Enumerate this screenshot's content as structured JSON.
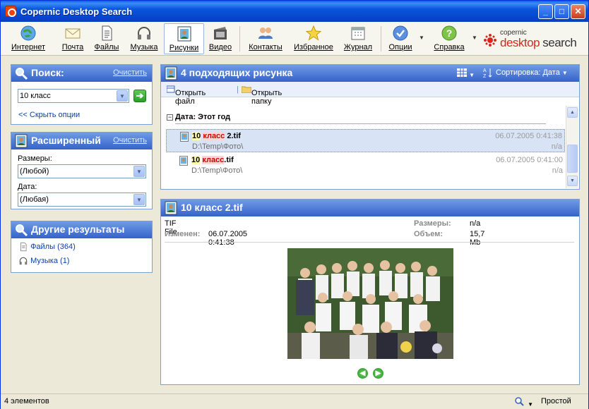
{
  "window": {
    "title": "Copernic Desktop Search"
  },
  "toolbar": {
    "items": [
      {
        "label": "Интернет",
        "icon": "globe-icon"
      },
      {
        "label": "Почта",
        "icon": "mail-icon"
      },
      {
        "label": "Файлы",
        "icon": "document-icon"
      },
      {
        "label": "Музыка",
        "icon": "headphones-icon"
      },
      {
        "label": "Рисунки",
        "icon": "picture-icon"
      },
      {
        "label": "Видео",
        "icon": "film-icon"
      },
      {
        "label": "Контакты",
        "icon": "contacts-icon"
      },
      {
        "label": "Избранное",
        "icon": "star-icon"
      },
      {
        "label": "Журнал",
        "icon": "calendar-icon"
      },
      {
        "label": "Опции",
        "icon": "checkmark-icon"
      },
      {
        "label": "Справка",
        "icon": "help-icon"
      }
    ],
    "active": "Рисунки"
  },
  "logo": {
    "small": "copernic",
    "big_part1": "desktop",
    "big_part2": " search"
  },
  "search_panel": {
    "title": "Поиск:",
    "clear_link": "Очистить",
    "query": "10 класс",
    "hide_options_link": "<< Скрыть опции"
  },
  "advanced_panel": {
    "title": "Расширенный",
    "clear_link": "Очистить",
    "size_label": "Размеры:",
    "size_value": "(Любой)",
    "date_label": "Дата:",
    "date_value": "(Любая)"
  },
  "other_results": {
    "title": "Другие результаты",
    "items": [
      {
        "label": "Файлы (364)",
        "icon": "document-icon"
      },
      {
        "label": "Музыка (1)",
        "icon": "headphones-icon"
      }
    ]
  },
  "results": {
    "title": "4 подходящих рисунка",
    "sort_label": "Сортировка: Дата",
    "open_file": "Открыть файл",
    "open_folder": "Открыть папку",
    "group_title": "Дата: Этот год",
    "rows": [
      {
        "name_hl1": "10",
        "name_hl2": "класс",
        "name_rest": " 2.tif",
        "path": "D:\\Temp\\Фото\\",
        "date": "06.07.2005 0:41:38",
        "size": "n/a"
      },
      {
        "name_hl1": "10",
        "name_hl2": "класс",
        "name_rest": ".tif",
        "path": "D:\\Temp\\Фото\\",
        "date": "06.07.2005 0:41:00",
        "size": "n/a"
      }
    ]
  },
  "preview": {
    "title": "10 класс 2.tif",
    "type": "TIF File",
    "modified_label": "Изменен:",
    "modified_value": "06.07.2005 0:41:38",
    "dims_label": "Размеры:",
    "dims_value": "n/a",
    "size_label": "Объем:",
    "size_value": "15,7 Mb"
  },
  "status": {
    "count": "4 элементов",
    "mode": "Простой"
  },
  "colors": {
    "accent": "#3563c9",
    "title_bar": "#0a55dc"
  }
}
